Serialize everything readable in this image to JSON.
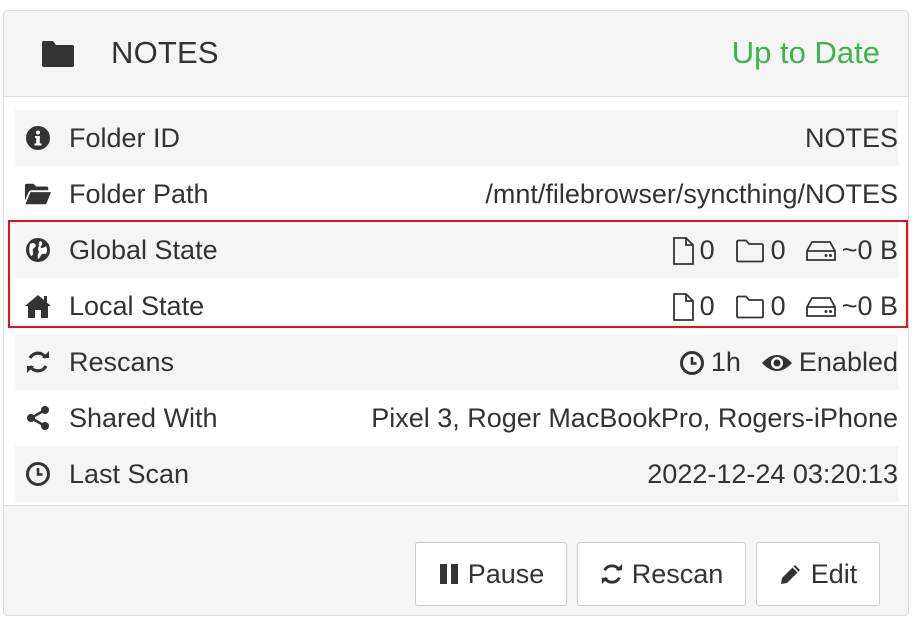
{
  "folder": {
    "name": "NOTES",
    "status": "Up to Date",
    "status_color": "#3cb44b",
    "icon": "folder-icon"
  },
  "rows": {
    "folder_id": {
      "label": "Folder ID",
      "value": "NOTES",
      "icon": "info-circle-icon"
    },
    "folder_path": {
      "label": "Folder Path",
      "value": "/mnt/filebrowser/syncthing/NOTES",
      "icon": "folder-open-icon"
    },
    "global_state": {
      "label": "Global State",
      "files": "0",
      "dirs": "0",
      "size": "~0 B",
      "icon": "globe-icon"
    },
    "local_state": {
      "label": "Local State",
      "files": "0",
      "dirs": "0",
      "size": "~0 B",
      "icon": "home-icon"
    },
    "rescans": {
      "label": "Rescans",
      "interval": "1h",
      "watcher": "Enabled",
      "icon": "refresh-icon"
    },
    "shared_with": {
      "label": "Shared With",
      "value": "Pixel 3, Roger MacBookPro, Rogers-iPhone",
      "icon": "share-icon"
    },
    "last_scan": {
      "label": "Last Scan",
      "value": "2022-12-24 03:20:13",
      "icon": "clock-icon"
    }
  },
  "highlight_color": "#e0141e",
  "buttons": {
    "pause": "Pause",
    "rescan": "Rescan",
    "edit": "Edit"
  }
}
